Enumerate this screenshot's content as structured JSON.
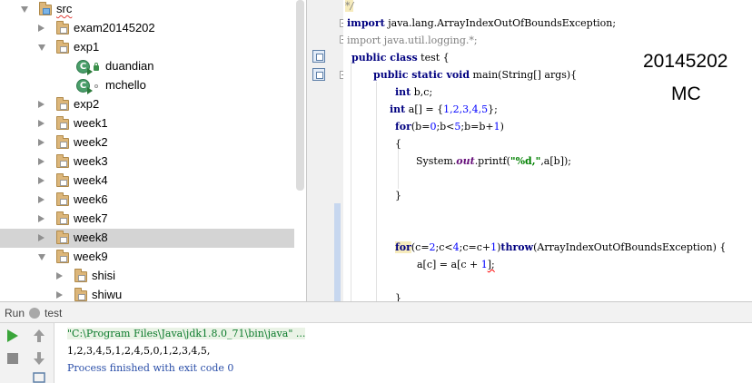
{
  "tree": {
    "items": [
      {
        "label": "src",
        "kind": "src-folder",
        "expanded": true
      },
      {
        "label": "exam20145202",
        "kind": "package",
        "expanded": false
      },
      {
        "label": "exp1",
        "kind": "package",
        "expanded": true
      },
      {
        "label": "duandian",
        "kind": "class",
        "modifier": "lock"
      },
      {
        "label": "mchello",
        "kind": "class",
        "modifier": "dot"
      },
      {
        "label": "exp2",
        "kind": "package",
        "expanded": false
      },
      {
        "label": "week1",
        "kind": "package",
        "expanded": false
      },
      {
        "label": "week2",
        "kind": "package",
        "expanded": false
      },
      {
        "label": "week3",
        "kind": "package",
        "expanded": false
      },
      {
        "label": "week4",
        "kind": "package",
        "expanded": false
      },
      {
        "label": "week6",
        "kind": "package",
        "expanded": false
      },
      {
        "label": "week7",
        "kind": "package",
        "expanded": false
      },
      {
        "label": "week8",
        "kind": "package",
        "expanded": false,
        "selected": true
      },
      {
        "label": "week9",
        "kind": "package",
        "expanded": true
      },
      {
        "label": "shisi",
        "kind": "package",
        "expanded": false
      },
      {
        "label": "shiwu",
        "kind": "package",
        "expanded": false
      }
    ]
  },
  "editor": {
    "comment_end": "*/",
    "import1_kw": "import",
    "import1_rest": " java.lang.ArrayIndexOutOfBoundsException;",
    "import2_kw": "import",
    "import2_rest": " java.util.logging.*;",
    "class_kw": "public class",
    "class_rest": " test {",
    "main_kw": "public static void",
    "main_rest": " main(String[] args){",
    "decl_kw": "int",
    "decl_rest": " b,c;",
    "arr_kw": "int",
    "arr_mid": " a[] = {",
    "arr_vals": "1,2,3,4,5",
    "arr_end": "};",
    "for1_kw": "for",
    "for1_p1": "(b=",
    "for1_n1": "0",
    "for1_p2": ";b<",
    "for1_n2": "5",
    "for1_p3": ";b=b+",
    "for1_n3": "1",
    "for1_p4": ")",
    "open_brace": "{",
    "print_pre": "System.",
    "print_out": "out",
    "print_mid": ".printf(",
    "print_str": "\"%d,\"",
    "print_end": ",a[b]);",
    "close_brace": "}",
    "for2_kw": "for",
    "for2_p1": "(c=",
    "for2_n1": "2",
    "for2_p2": ";c<",
    "for2_n2": "4",
    "for2_p3": ";c=c+",
    "for2_n3": "1",
    "for2_p4": ")",
    "throw_kw": "throw",
    "throw_rest": "(ArrayIndexOutOfBoundsException) {",
    "assign_pre": "a[c] = a[c + ",
    "assign_num": "1",
    "assign_end": "];",
    "close_brace2": "}"
  },
  "overlay": {
    "line1": "20145202",
    "line2": "MC"
  },
  "run_panel": {
    "label": "Run",
    "tab": "test",
    "cmd": "\"C:\\Program Files\\Java\\jdk1.8.0_71\\bin\\java\" ...",
    "output": "1,2,3,4,5,1,2,4,5,0,1,2,3,4,5,",
    "exit": "Process finished with exit code 0"
  },
  "colors": {
    "keyword": "#000080",
    "number": "#0000ff",
    "string": "#008000",
    "field": "#660e7a",
    "selected_row": "#d4d4d4",
    "console_cmd": "#0b7a2b",
    "console_exit": "#2a4ea8"
  }
}
